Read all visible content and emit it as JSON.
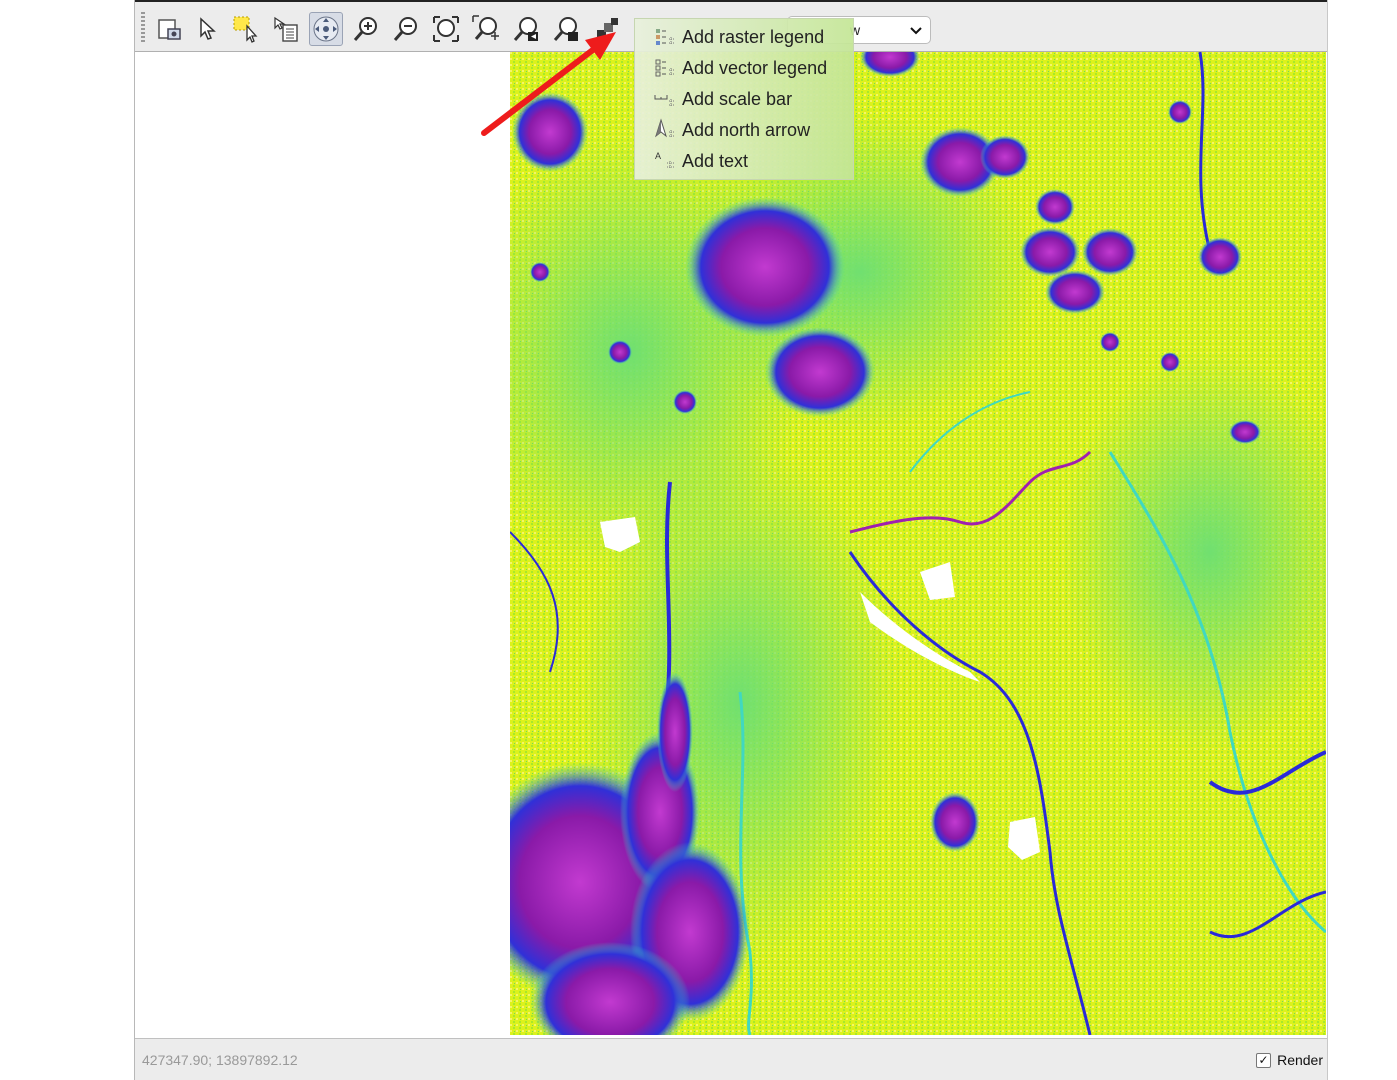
{
  "toolbar": {
    "tools": [
      {
        "icon": "print-preview-icon"
      },
      {
        "icon": "select-arrow-icon"
      },
      {
        "icon": "select-feature-icon"
      },
      {
        "icon": "identify-icon"
      },
      {
        "icon": "pan-icon"
      },
      {
        "icon": "zoom-in-icon"
      },
      {
        "icon": "zoom-out-icon"
      },
      {
        "icon": "zoom-full-icon"
      },
      {
        "icon": "zoom-to-selection-icon"
      },
      {
        "icon": "zoom-last-icon"
      },
      {
        "icon": "zoom-next-icon"
      },
      {
        "icon": "add-map-item-icon"
      }
    ],
    "combo_visible_text": "w"
  },
  "context_menu": {
    "items": [
      {
        "label": "Add raster legend",
        "icon": "raster-legend-icon"
      },
      {
        "label": "Add vector legend",
        "icon": "vector-legend-icon"
      },
      {
        "label": "Add scale bar",
        "icon": "scale-bar-icon"
      },
      {
        "label": "Add north arrow",
        "icon": "north-arrow-icon"
      },
      {
        "label": "Add text",
        "icon": "text-icon"
      }
    ]
  },
  "statusbar": {
    "coordinates": "427347.90; 13897892.12",
    "render_label": "Render",
    "render_checked": "✓"
  },
  "colors": {
    "annotation_arrow": "#ee1c1c",
    "map_yellow": "#e8f23a",
    "map_green": "#9aef3a",
    "map_cyan": "#40d8c0",
    "map_blue": "#2a2ad8",
    "map_magenta": "#a020b0"
  }
}
